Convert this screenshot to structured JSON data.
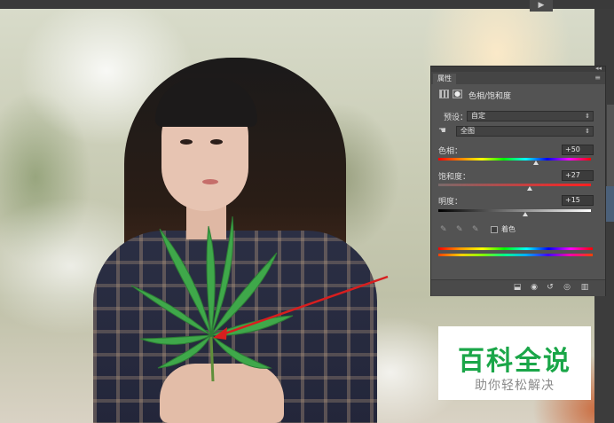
{
  "panel": {
    "tab_label": "属性",
    "adjustment_title": "色相/饱和度",
    "preset_label": "预设：",
    "preset_value": "自定",
    "channel_value": "全图",
    "hue": {
      "label": "色相：",
      "value": "+50",
      "level": 0.64
    },
    "saturation": {
      "label": "饱和度：",
      "value": "+27",
      "level": 0.6
    },
    "lightness": {
      "label": "明度：",
      "value": "+15",
      "level": 0.57
    },
    "colorize_label": "着色"
  },
  "watermark": {
    "title": "百科全说",
    "subtitle": "助你轻松解决"
  },
  "colors": {
    "panel_bg": "#535353",
    "watermark_green": "#1aa648",
    "annotation_arrow": "#d81e1e"
  }
}
